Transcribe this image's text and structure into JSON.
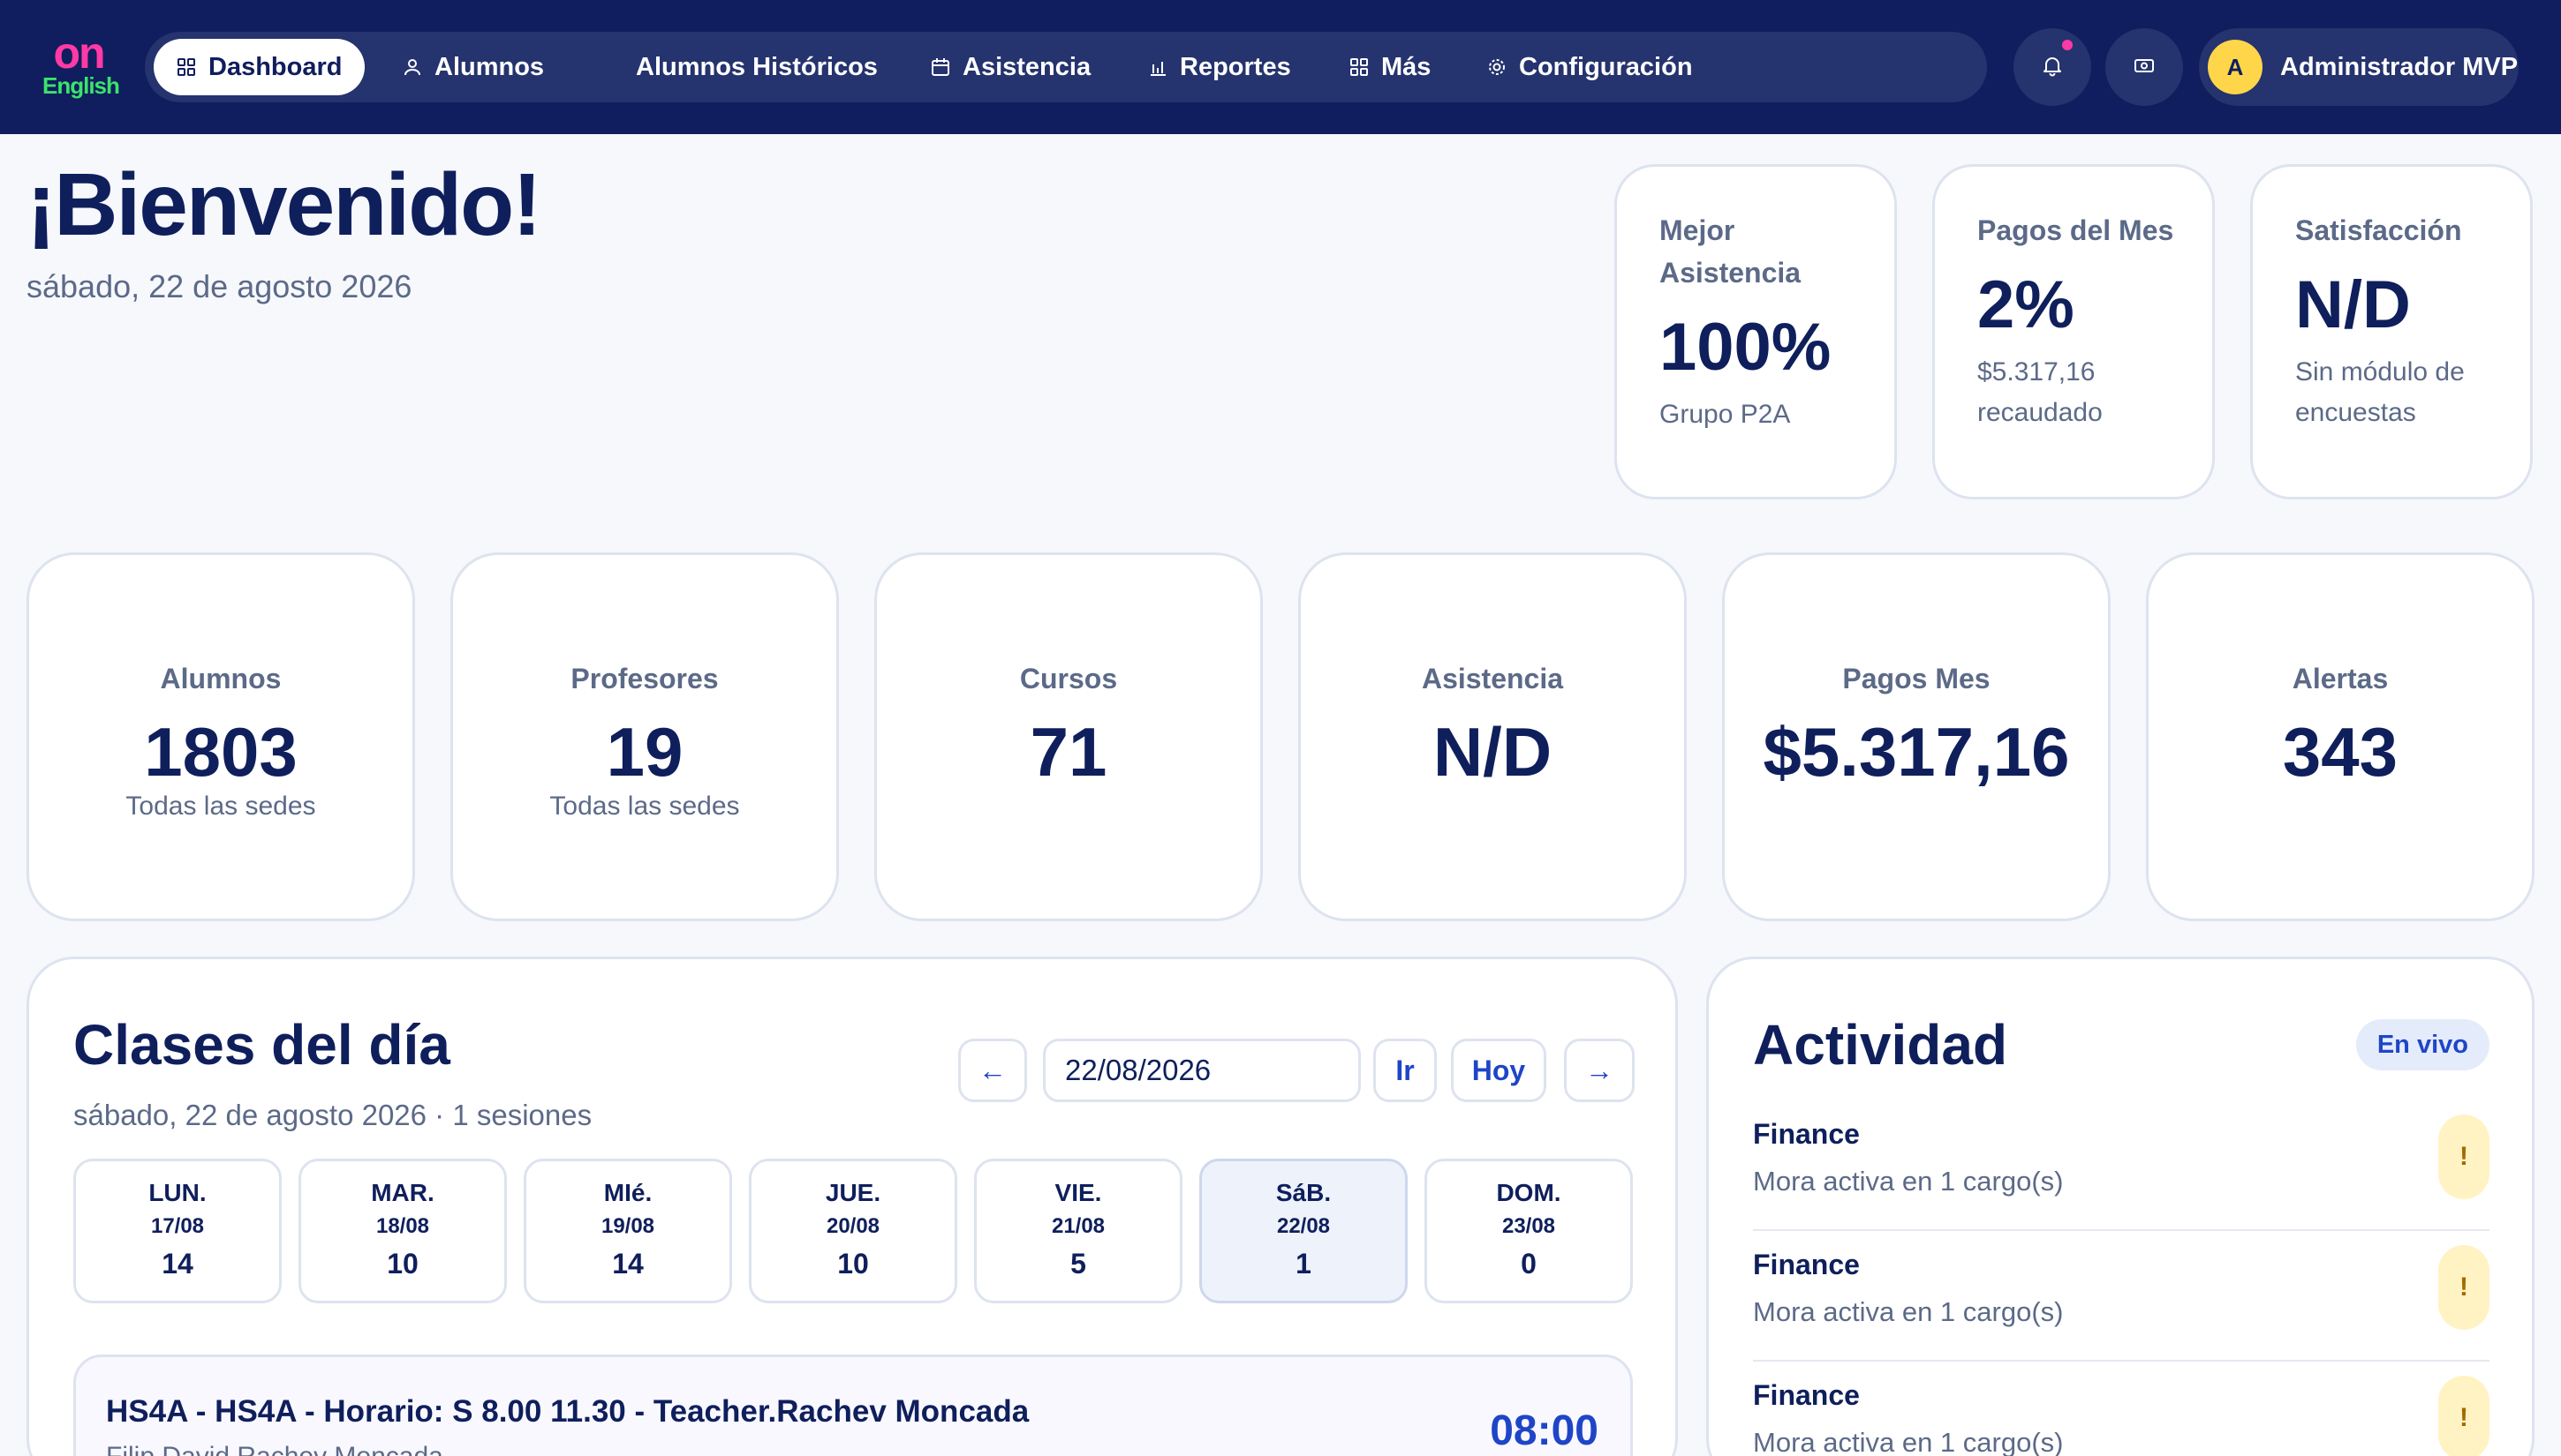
{
  "logo": {
    "top": "on",
    "bottom": "English"
  },
  "nav": {
    "items": [
      {
        "label": "Dashboard",
        "icon": "grid-icon",
        "active": true
      },
      {
        "label": "Alumnos",
        "icon": "user-icon"
      },
      {
        "label": "Alumnos Históricos",
        "icon": ""
      },
      {
        "label": "Asistencia",
        "icon": "calendar-icon"
      },
      {
        "label": "Reportes",
        "icon": "bar-chart-icon"
      },
      {
        "label": "Más",
        "icon": "grid-icon"
      },
      {
        "label": "Configuración",
        "icon": "gear-icon"
      }
    ],
    "user": {
      "initial": "A",
      "name": "Administrador MVP"
    }
  },
  "welcome": {
    "title": "¡Bienvenido!",
    "date": "sábado, 22 de agosto 2026"
  },
  "top_cards": [
    {
      "label": "Mejor Asistencia",
      "value": "100%",
      "sub": "Grupo P2A"
    },
    {
      "label": "Pagos del Mes",
      "value": "2%",
      "sub": "$5.317,16 recaudado"
    },
    {
      "label": "Satisfacción",
      "value": "N/D",
      "sub": "Sin módulo de encuestas"
    }
  ],
  "stats": [
    {
      "label": "Alumnos",
      "value": "1803",
      "sub": "Todas las sedes"
    },
    {
      "label": "Profesores",
      "value": "19",
      "sub": "Todas las sedes"
    },
    {
      "label": "Cursos",
      "value": "71",
      "sub": ""
    },
    {
      "label": "Asistencia",
      "value": "N/D",
      "sub": ""
    },
    {
      "label": "Pagos Mes",
      "value": "$5.317,16",
      "sub": ""
    },
    {
      "label": "Alertas",
      "value": "343",
      "sub": ""
    }
  ],
  "classes": {
    "title": "Clases del día",
    "subtitle": "sábado, 22 de agosto 2026 · 1 sesiones",
    "prev": "←",
    "next": "→",
    "date_value": "22/08/2026",
    "go_label": "Ir",
    "today_label": "Hoy",
    "days": [
      {
        "name": "LUN.",
        "date": "17/08",
        "count": "14"
      },
      {
        "name": "MAR.",
        "date": "18/08",
        "count": "10"
      },
      {
        "name": "MIé.",
        "date": "19/08",
        "count": "14"
      },
      {
        "name": "JUE.",
        "date": "20/08",
        "count": "10"
      },
      {
        "name": "VIE.",
        "date": "21/08",
        "count": "5"
      },
      {
        "name": "SáB.",
        "date": "22/08",
        "count": "1",
        "selected": true
      },
      {
        "name": "DOM.",
        "date": "23/08",
        "count": "0"
      }
    ],
    "session": {
      "title": "HS4A - HS4A - Horario: S 8.00 11.30 - Teacher.Rachev Moncada",
      "teacher": "Filip David Rachev Moncada",
      "time": "08:00"
    }
  },
  "activity": {
    "title": "Actividad",
    "badge": "En vivo",
    "items": [
      {
        "title": "Finance",
        "desc": "Mora activa en 1 cargo(s)",
        "flag": "!"
      },
      {
        "title": "Finance",
        "desc": "Mora activa en 1 cargo(s)",
        "flag": "!"
      },
      {
        "title": "Finance",
        "desc": "Mora activa en 1 cargo(s)",
        "flag": "!"
      }
    ]
  },
  "colors": {
    "nav_bg": "#101d5e",
    "accent": "#1f45c7",
    "brand_pink": "#ff3aa6",
    "brand_green": "#3be36a"
  }
}
